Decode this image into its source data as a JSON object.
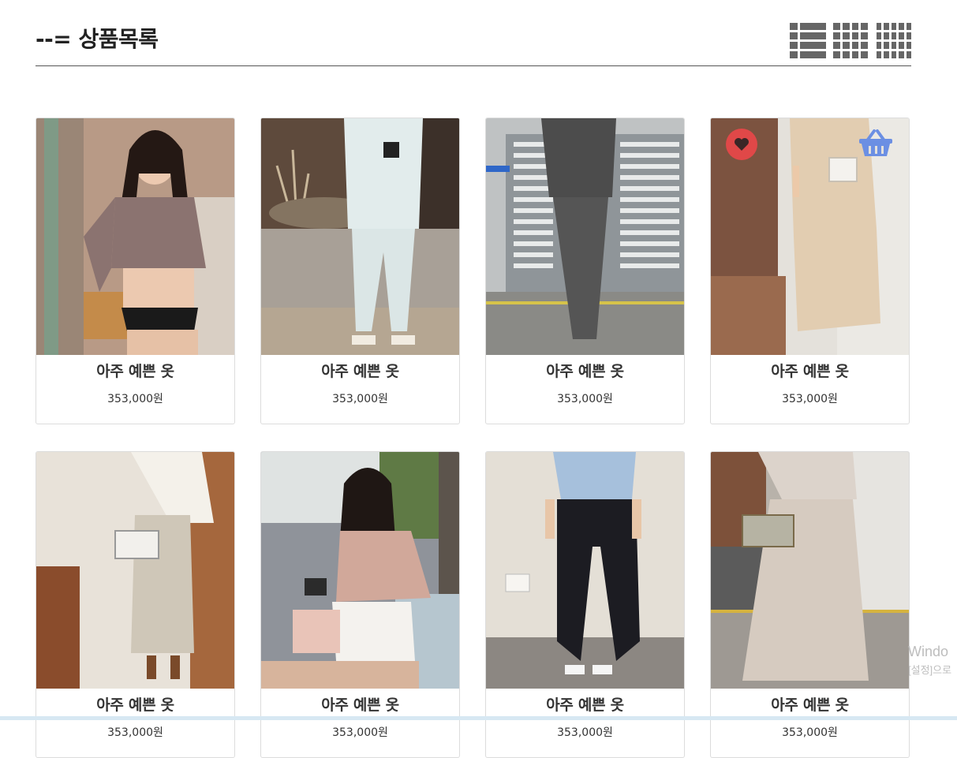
{
  "header": {
    "title": "--= 상품목록",
    "view_modes": [
      "list-view-icon",
      "grid-3-view-icon",
      "grid-4-view-icon"
    ]
  },
  "products": [
    {
      "name": "아주 예쁜 옷",
      "price": "353,000원",
      "image": "woman-mauve-wrap-top"
    },
    {
      "name": "아주 예쁜 옷",
      "price": "353,000원",
      "image": "white-pleated-set"
    },
    {
      "name": "아주 예쁜 옷",
      "price": "353,000원",
      "image": "gray-tshirt-long-skirt"
    },
    {
      "name": "아주 예쁜 옷",
      "price": "353,000원",
      "image": "beige-shirt-dress",
      "hover_actions": true
    },
    {
      "name": "아주 예쁜 옷",
      "price": "353,000원",
      "image": "cream-knit-pleated-skirt"
    },
    {
      "name": "아주 예쁜 옷",
      "price": "353,000원",
      "image": "pink-blouse-lace-skirt"
    },
    {
      "name": "아주 예쁜 옷",
      "price": "353,000원",
      "image": "blue-top-black-pants"
    },
    {
      "name": "아주 예쁜 옷",
      "price": "353,000원",
      "image": "beige-long-dress"
    }
  ],
  "overlay": {
    "watermark_line1": "Windo",
    "watermark_line2": "[설정]으로"
  },
  "colors": {
    "heart_button": "#e04848",
    "cart_icon": "#6b8fe3",
    "view_icon": "#666666"
  }
}
